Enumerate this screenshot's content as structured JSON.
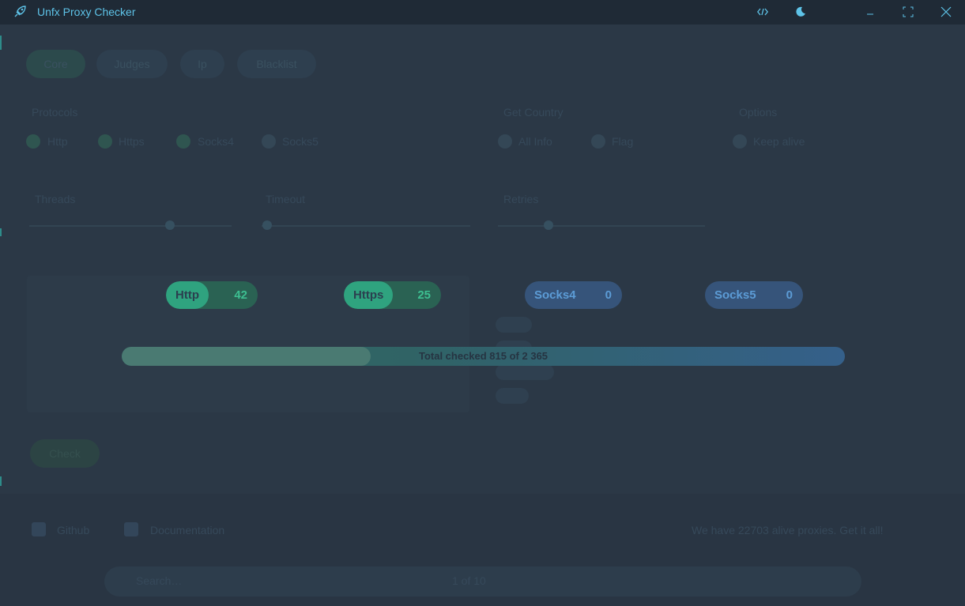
{
  "window": {
    "title": "Unfx Proxy Checker"
  },
  "background": {
    "tabs": [
      "Core",
      "Judges",
      "Ip",
      "Blacklist"
    ],
    "section_protocols": "Protocols",
    "protocols": [
      "Http",
      "Https",
      "Socks4",
      "Socks5"
    ],
    "section_get_country": "Get Country",
    "get_country": [
      "All Info",
      "Flag"
    ],
    "section_options": "Options",
    "options_item": "Keep alive",
    "threads_label": "Threads",
    "timeout_label": "Timeout",
    "retries_label": "Retries",
    "check_button": "Check",
    "footer_links": [
      "Github",
      "Documentation"
    ],
    "footer_promo": "We have 22703 alive proxies. Get it all!",
    "input_placeholder": "Search…",
    "pages": "1 of 10"
  },
  "counters": [
    {
      "label": "Http",
      "value": "42"
    },
    {
      "label": "Https",
      "value": "25"
    },
    {
      "label": "Socks4",
      "value": "0"
    },
    {
      "label": "Socks5",
      "value": "0"
    }
  ],
  "progress": {
    "text": "Total checked 815 of 2 365",
    "checked": 815,
    "total": 2365
  },
  "colors": {
    "accent_green": "#2fa37f",
    "accent_blue": "#5c9cd6",
    "title_blue": "#5ec3e8"
  }
}
